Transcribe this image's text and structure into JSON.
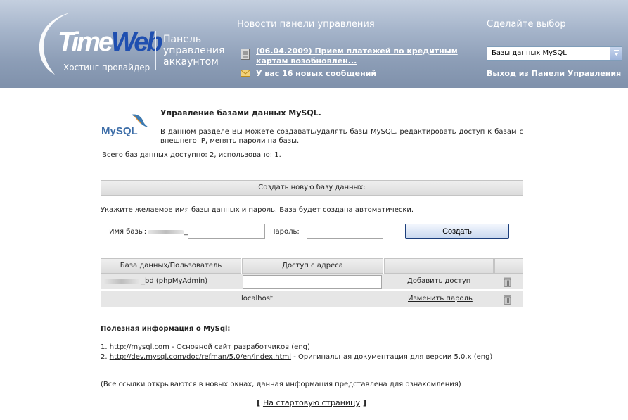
{
  "header": {
    "logo_time": "Time",
    "logo_web": "Web",
    "logo_subtitle": "Хостинг провайдер",
    "panel_title": "Панель управления аккаунтом",
    "news_title": "Новости панели управления",
    "news_link": "(06.04.2009) Прием платежей по кредитным картам возобновлен...",
    "messages_link": "У вас 16 новых сообщений",
    "choose_title": "Сделайте выбор",
    "select_value": "Базы данных MySQL",
    "logout_link": "Выход из Панели Управления"
  },
  "main": {
    "title": "Управление базами данных MySQL.",
    "description": "В данном разделе Вы можете создавать/удалять базы MySQL, редактировать доступ к базам с внешнего IP, менять пароли на базы.",
    "db_count": "Всего баз данных доступно: 2, использовано: 1.",
    "create_bar": "Создать новую базу данных:",
    "hint": "Укажите желаемое имя базы данных и пароль. База будет создана автоматически.",
    "db_name_label": "Имя базы:",
    "db_name_suffix": "_",
    "password_label": "Пароль:",
    "create_button": "Создать"
  },
  "table": {
    "headers": [
      "База данных/Пользователь",
      "Доступ с адреса",
      "",
      ""
    ],
    "rows": [
      {
        "name_suffix": "_bd (",
        "phpmyadmin": "phpMyAdmin",
        "name_close": ")",
        "action": "Добавить доступ"
      },
      {
        "host": "localhost",
        "action": "Изменить пароль"
      }
    ]
  },
  "useful": {
    "title": "Полезная информация о MySql:",
    "items": [
      {
        "num": "1. ",
        "url": "http://mysql.com",
        "desc": " - Основной сайт разработчиков (eng)"
      },
      {
        "num": "2. ",
        "url": "http://dev.mysql.com/doc/refman/5.0/en/index.html",
        "desc": " - Оригинальная документация для версии 5.0.x (eng)"
      }
    ],
    "note": "(Все ссылки открываются в новых окнах, данная информация представлена для ознакомления)"
  },
  "footer": {
    "open": "[ ",
    "home_link": "На стартовую страницу",
    "close": " ]"
  },
  "mysql_logo_text": "MySQL"
}
